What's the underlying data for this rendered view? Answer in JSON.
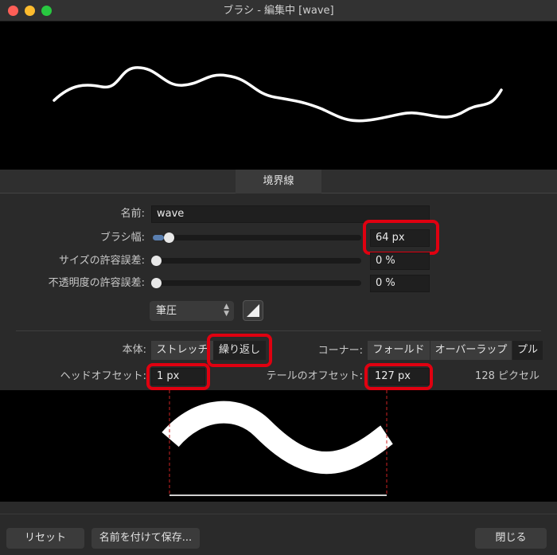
{
  "window": {
    "title": "ブラシ - 編集中 [wave]",
    "colors": {
      "close": "#ff5f57",
      "minimize": "#febc2e",
      "zoom": "#28c840"
    }
  },
  "tab": {
    "label": "境界線"
  },
  "form": {
    "name_label": "名前:",
    "name_value": "wave",
    "width_label": "ブラシ幅:",
    "width_value": "64 px",
    "width_level": 0.03,
    "size_tol_label": "サイズの許容誤差:",
    "size_tol_value": "0 %",
    "opacity_tol_label": "不透明度の許容誤差:",
    "opacity_tol_value": "0 %",
    "pressure_select": "筆圧"
  },
  "body": {
    "label": "本体:",
    "options": [
      "ストレッチ",
      "繰り返し"
    ],
    "selected": "繰り返し"
  },
  "corner": {
    "label": "コーナー:",
    "options": [
      "フォールド",
      "オーバーラップ",
      "プル"
    ]
  },
  "offsets": {
    "head_label": "ヘッドオフセット:",
    "head_value": "1 px",
    "tail_label": "テールのオフセット:",
    "tail_value": "127 px",
    "total": "128 ピクセル"
  },
  "buttons": {
    "reset": "リセット",
    "save_as": "名前を付けて保存...",
    "close": "閉じる"
  },
  "highlight_color": "#e00010"
}
